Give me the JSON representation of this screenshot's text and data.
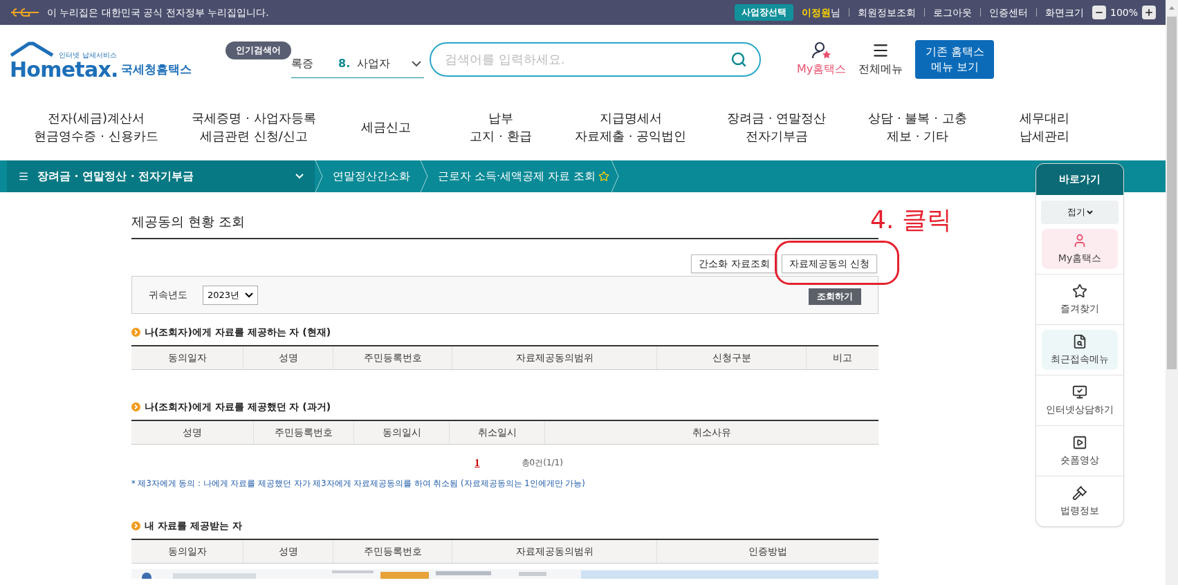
{
  "top_bar": {
    "notice": "이 누리집은 대한민국 공식 전자정부 누리집입니다.",
    "workplace_button": "사업장선택",
    "user_name": "이정원",
    "user_suffix": "님",
    "links": [
      "회원정보조회",
      "로그아웃",
      "인증센터"
    ],
    "zoom_label": "화면크기",
    "zoom_value": "100%"
  },
  "header": {
    "logo": {
      "tagline": "인터넷 납세서비스",
      "wordmark": "Hometax.",
      "name": "국세청홈택스"
    },
    "popular_badge": "인기검색어",
    "rolling_keyword": "록증",
    "category": {
      "number": "8.",
      "label": "사업자"
    },
    "search": {
      "placeholder": "검색어를 입력하세요."
    },
    "my_link": "My홈택스",
    "all_menu": "전체메뉴",
    "legacy_button": [
      "기존 홈택스",
      "메뉴 보기"
    ]
  },
  "main_menu": [
    {
      "lines": [
        "전자(세금)계산서",
        "현금영수증 · 신용카드"
      ]
    },
    {
      "lines": [
        "국세증명 · 사업자등록",
        "세금관련 신청/신고"
      ]
    },
    {
      "lines": [
        "세금신고"
      ]
    },
    {
      "lines": [
        "납부",
        "고지 · 환급"
      ]
    },
    {
      "lines": [
        "지급명세서",
        "자료제출 · 공익법인"
      ]
    },
    {
      "lines": [
        "장려금 · 연말정산",
        "전자기부금"
      ]
    },
    {
      "lines": [
        "상담 · 불복 · 고충",
        "제보 · 기타"
      ]
    },
    {
      "lines": [
        "세무대리",
        "납세관리"
      ]
    }
  ],
  "breadcrumb": {
    "menu": "장려금 · 연말정산 · 전자기부금",
    "items": [
      "연말정산간소화",
      "근로자 소득·세액공제 자료 조회"
    ]
  },
  "page": {
    "title": "제공동의 현황 조회",
    "buttons": [
      "간소화 자료조회",
      "자료제공동의 신청"
    ],
    "filter": {
      "label": "귀속년도",
      "year": "2023년",
      "submit": "조회하기"
    },
    "sections": [
      {
        "title": "나(조회자)에게 자료를 제공하는 자 (현재)",
        "columns": [
          "동의일자",
          "성명",
          "주민등록번호",
          "자료제공동의범위",
          "신청구분",
          "비고"
        ]
      },
      {
        "title": "나(조회자)에게 자료를 제공했던 자 (과거)",
        "columns": [
          "성명",
          "주민등록번호",
          "동의일시",
          "취소일시",
          "취소사유"
        ],
        "pagination": {
          "page": "1",
          "total": "총0건(1/1)"
        },
        "note": "* 제3자에게 동의 : 나에게 자료를 제공했던 자가 제3자에게 자료제공동의를 하여 취소됨 (자료제공동의는 1인에게만 가능)"
      },
      {
        "title": "내 자료를 제공받는 자",
        "columns": [
          "동의일자",
          "성명",
          "주민등록번호",
          "자료제공동의범위",
          "인증방법"
        ],
        "kind": "picture"
      }
    ]
  },
  "annotation": {
    "text": "4. 클릭"
  },
  "quick_menu": {
    "title": "바로가기",
    "collapse": "접기",
    "items": [
      {
        "label": "My홈택스",
        "kind": "pink"
      },
      {
        "label": "즐겨찾기",
        "kind": "plain"
      },
      {
        "label": "최근접속메뉴",
        "kind": "teal"
      },
      {
        "label": "인터넷상담하기",
        "kind": "plain"
      },
      {
        "label": "숏폼영상",
        "kind": "plain"
      },
      {
        "label": "법령정보",
        "kind": "plain"
      }
    ]
  }
}
